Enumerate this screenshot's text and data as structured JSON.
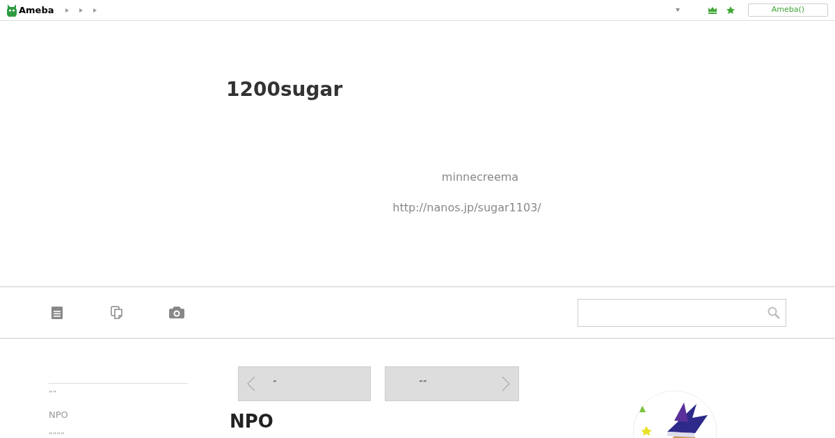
{
  "top_bar": {
    "logo": "Ameba",
    "account_button": "Ameba()"
  },
  "blog_header": {
    "title": "1200sugar",
    "description": "minnecreema",
    "url": "http://nanos.jp/sugar1103/"
  },
  "nav_tabs": [
    {
      "kind": "entries"
    },
    {
      "kind": "themes"
    },
    {
      "kind": "images"
    }
  ],
  "sidebar": {
    "items": [
      "””",
      "NPO",
      "””””"
    ]
  },
  "pager": {
    "prev": "”",
    "next": "””"
  },
  "article": {
    "title": "NPO"
  }
}
